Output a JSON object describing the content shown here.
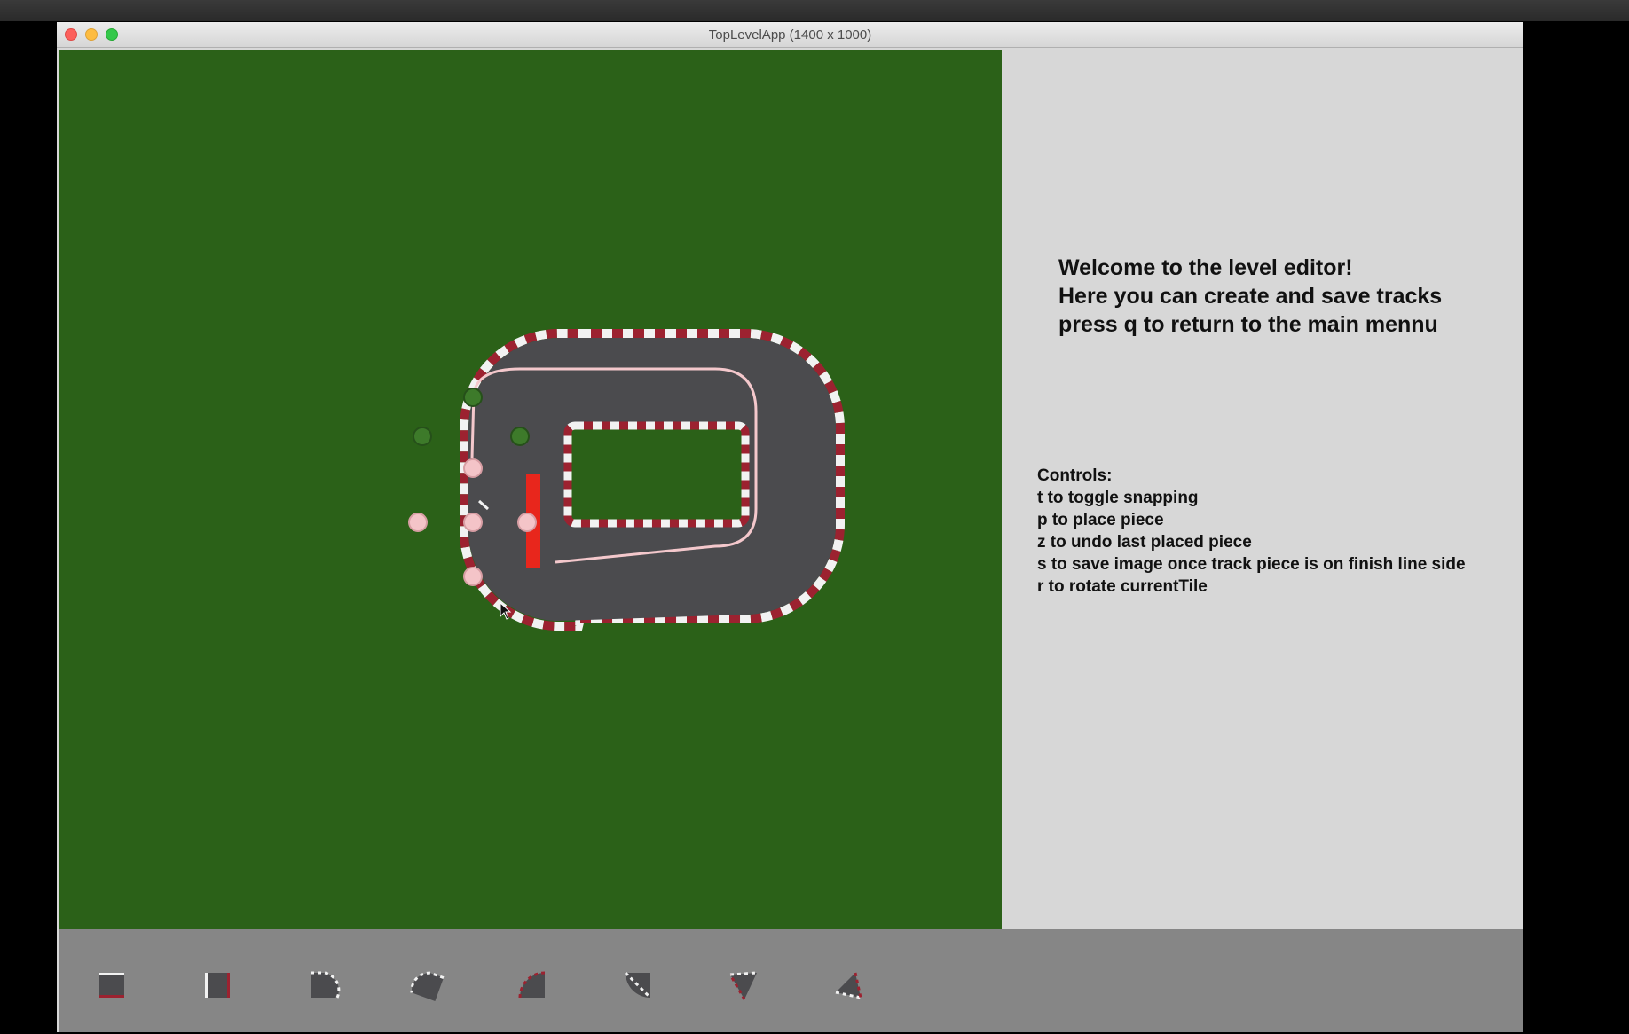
{
  "window": {
    "title": "TopLevelApp (1400 x 1000)"
  },
  "info": {
    "welcome_lines": [
      "Welcome to the level editor!",
      "Here you can create and save tracks",
      "press q to return to the main mennu"
    ],
    "controls_title": "Controls:",
    "controls": [
      "t to toggle snapping",
      "p to place piece",
      "z to undo last placed piece",
      "s to save image once track piece is on finish line side",
      "r to rotate currentTile"
    ]
  },
  "colors": {
    "grass": "#2b6118",
    "asphalt": "#4b4b4e",
    "kerb_red": "#9c2230",
    "kerb_white": "#f2f2f2",
    "finish_line": "#e8261c",
    "racing_line": "#f4c8cc",
    "panel": "#d7d7d7",
    "palette_bar": "#868686"
  },
  "palette": {
    "tiles": [
      {
        "name": "straight-horizontal-tile",
        "icon": "straight-horizontal-icon"
      },
      {
        "name": "straight-vertical-tile",
        "icon": "straight-vertical-icon"
      },
      {
        "name": "curve-tile-1",
        "icon": "curve-1-icon"
      },
      {
        "name": "curve-tile-2",
        "icon": "curve-2-icon"
      },
      {
        "name": "curve-tile-3",
        "icon": "curve-3-icon"
      },
      {
        "name": "curve-tile-4",
        "icon": "curve-4-icon"
      },
      {
        "name": "corner-tile-1",
        "icon": "corner-1-icon"
      },
      {
        "name": "corner-tile-2",
        "icon": "corner-2-icon"
      }
    ]
  }
}
